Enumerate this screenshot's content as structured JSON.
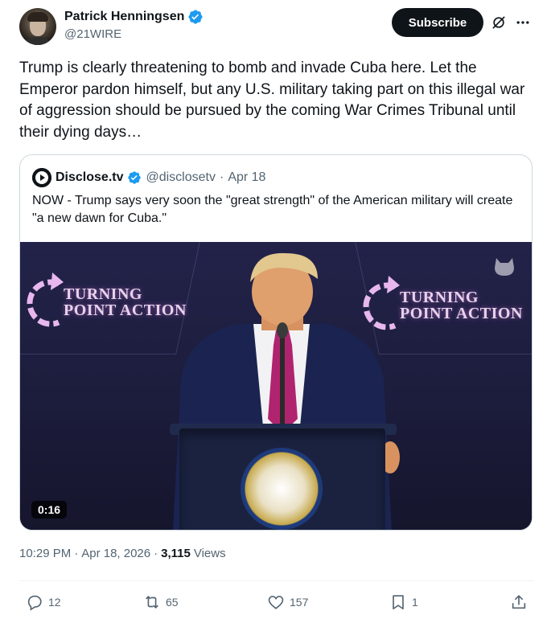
{
  "author": {
    "display_name": "Patrick Henningsen",
    "handle": "@21WIRE",
    "verified": true
  },
  "header_actions": {
    "subscribe_label": "Subscribe",
    "grok_icon": "grok-slash-icon",
    "more_icon": "more-dots-icon"
  },
  "tweet": {
    "text": "Trump is clearly threatening to bomb and invade Cuba here. Let the Emperor pardon himself, but any U.S. military taking part on this illegal war of aggression should be pursued by the coming War Crimes Tribunal until their dying days…"
  },
  "quote": {
    "display_name": "Disclose.tv",
    "handle": "@disclosetv",
    "separator": "·",
    "date": "Apr 18",
    "text": "NOW - Trump says very soon the \"great strength\" of the American military will create \"a new dawn for Cuba.\"",
    "video": {
      "duration": "0:16",
      "banner_left_line1": "TURNING",
      "banner_left_line2": "POINT ACTION",
      "banner_right_line1": "TURNING",
      "banner_right_line2": "POINT ACTION"
    }
  },
  "meta": {
    "time": "10:29 PM",
    "separator": "·",
    "date": "Apr 18, 2026",
    "separator2": "·",
    "views": "3,115",
    "views_label": "Views"
  },
  "actions": {
    "replies": "12",
    "reposts": "65",
    "likes": "157",
    "bookmarks": "1"
  },
  "colors": {
    "text_primary": "#0f1419",
    "text_secondary": "#536471",
    "verified_blue": "#1d9bf0",
    "border": "#cfd9de"
  }
}
